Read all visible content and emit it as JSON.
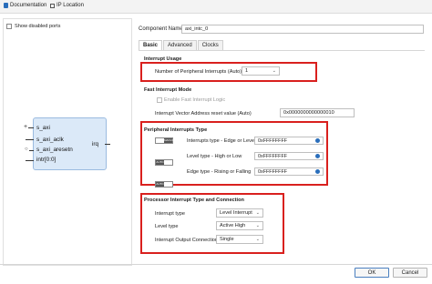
{
  "topbar": {
    "documentation": "Documentation",
    "ip_location": "IP Location"
  },
  "left": {
    "show_disabled_ports": "Show disabled ports",
    "ports": [
      "s_axi",
      "s_axi_aclk",
      "s_axi_aresetn",
      "intr[0:0]"
    ],
    "output_port": "irq"
  },
  "component": {
    "label": "Component Name",
    "value": "axi_intc_0"
  },
  "tabs": [
    "Basic",
    "Advanced",
    "Clocks"
  ],
  "interrupt_usage": {
    "title": "Interrupt Usage",
    "num_label": "Number of Peripheral Interrupts (Auto)",
    "num_value": "1"
  },
  "fast_mode": {
    "title": "Fast Interrupt Mode",
    "enable_label": "Enable Fast Interrupt Logic",
    "vector_label": "Interrupt Vector Address reset value (Auto)",
    "vector_value": "0x0000000000000010"
  },
  "peripheral": {
    "title": "Peripheral Interrupts Type",
    "rows": [
      {
        "toggle": "MANUAL",
        "label": "Interrupts type - Edge or Level",
        "value": "0xFFFFFFFF"
      },
      {
        "toggle": "AUTO",
        "label": "Level type - High or Low",
        "value": "0xFFFFFFFF"
      },
      {
        "toggle": "AUTO",
        "label": "Edge type - Rising or Falling",
        "value": "0xFFFFFFFF"
      }
    ]
  },
  "processor": {
    "title": "Processor Interrupt Type and Connection",
    "rows": [
      {
        "label": "Interrupt type",
        "value": "Level Interrupt"
      },
      {
        "label": "Level type",
        "value": "Active High"
      },
      {
        "label": "Interrupt Output Connection",
        "value": "Single"
      }
    ]
  },
  "buttons": {
    "ok": "OK",
    "cancel": "Cancel"
  },
  "colors": {
    "highlight": "#d9201e",
    "accent": "#2a6ebb"
  }
}
